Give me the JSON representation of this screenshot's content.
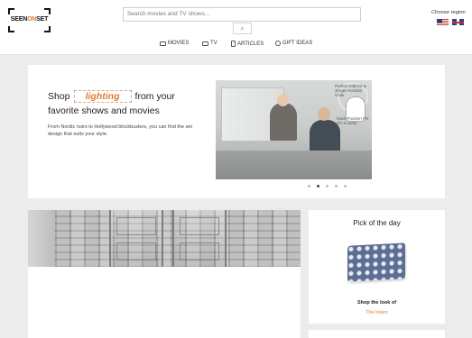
{
  "header": {
    "logo": {
      "pre": "SEEN",
      "mid": "ON",
      "post": "SET"
    },
    "search": {
      "placeholder": "Search movies and TV shows..."
    },
    "region_label": "Choose region",
    "nav": [
      {
        "label": "MOVIES",
        "icon": "film-icon"
      },
      {
        "label": "TV",
        "icon": "tv-icon"
      },
      {
        "label": "ARTICLES",
        "icon": "document-icon"
      },
      {
        "label": "GIFT IDEAS",
        "icon": "gift-icon"
      }
    ]
  },
  "hero": {
    "title_before": "Shop",
    "title_word": "lighting",
    "title_after": "from your favorite shows and movies",
    "subtitle": "From Nordic noirs to Hollywood blockbusters, you can find the set design that suits your style.",
    "slide_caption_1": "Prefect Fabricé & Jergen Korlatin Chair",
    "slide_caption_2": "Hack Poulsen PH 3½-3 Lamp",
    "dots": 5,
    "active_dot": 1
  },
  "pick": {
    "title": "Pick of the day",
    "shop_label": "Shop the look of",
    "show_title": "The Intern"
  },
  "colors": {
    "accent": "#e07b39",
    "background": "#ececec"
  }
}
